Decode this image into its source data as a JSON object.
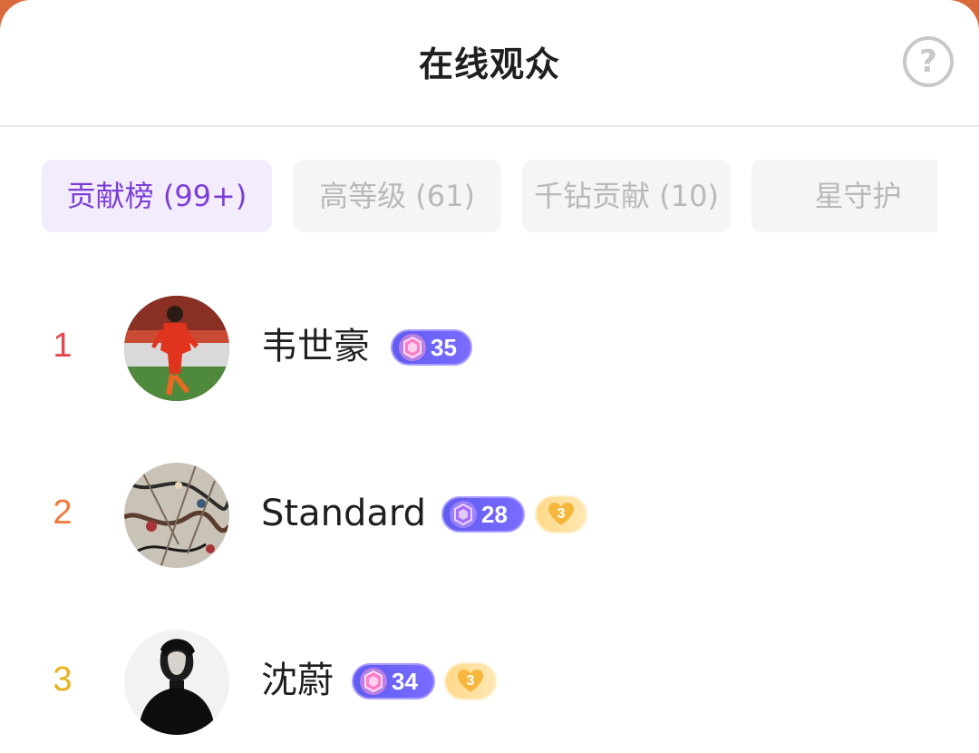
{
  "header": {
    "title": "在线观众",
    "help_icon": "question-circle-icon",
    "help_glyph": "?"
  },
  "tabs": [
    {
      "label": "贡献榜 (99+)",
      "active": true
    },
    {
      "label": "高等级 (61)",
      "active": false
    },
    {
      "label": "千钻贡献 (10)",
      "active": false
    },
    {
      "label": "星守护",
      "active": false
    }
  ],
  "colors": {
    "accent": "#7b3fd6",
    "rank_1": "#e5484d",
    "rank_2": "#f07a3c",
    "rank_3": "#e7b21c",
    "level_badge": "#6a5cf5",
    "fan_badge": "#ffd98a"
  },
  "viewers": [
    {
      "rank": "1",
      "name": "韦世豪",
      "level": "35",
      "fan_level": null,
      "avatar": "footballer-photo"
    },
    {
      "rank": "2",
      "name": "Standard",
      "level": "28",
      "fan_level": "3",
      "avatar": "abstract-painting"
    },
    {
      "rank": "3",
      "name": "沈蔚",
      "level": "34",
      "fan_level": "3",
      "avatar": "black-turtleneck-portrait"
    }
  ]
}
